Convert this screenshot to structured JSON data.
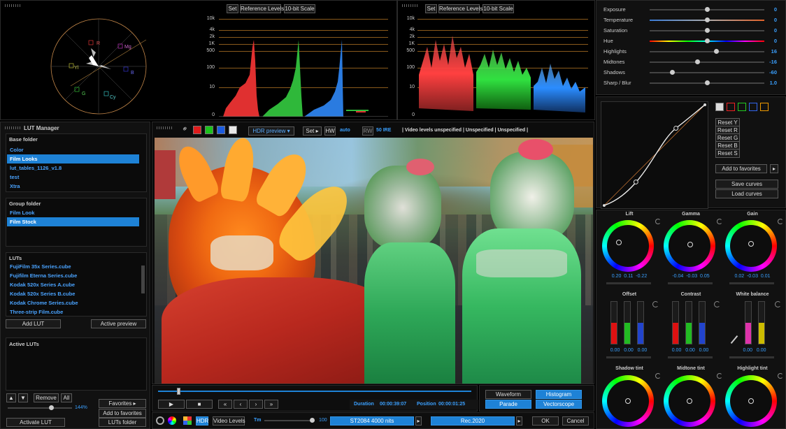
{
  "scopes": {
    "set_label": "Set",
    "ref_levels_label": "Reference Levels",
    "bit_scale_label": "10-bit Scale",
    "ticks": [
      "10k",
      "4k",
      "2k",
      "1K",
      "500",
      "100",
      "10",
      "0"
    ],
    "vectorscope_targets": [
      "R",
      "Mg",
      "B",
      "Cy",
      "G",
      "Yl"
    ]
  },
  "colors": {
    "accent": "#1e82d6",
    "value": "#3aa0ff",
    "grid": "#8a5a1c"
  },
  "lut_manager": {
    "title": "LUT Manager",
    "base_folder": {
      "title": "Base folder",
      "items": [
        "Color",
        "Film Looks",
        "lut_tables_1126_v1.8",
        "test",
        "Xtra"
      ],
      "selected": 1
    },
    "group_folder": {
      "title": "Group folder",
      "items": [
        "Film Look",
        "Film Stock"
      ],
      "selected": 1
    },
    "luts": {
      "title": "LUTs",
      "items": [
        "FujiFilm 35x Series.cube",
        "Fujifilm Eterna Series.cube",
        "Kodak 520x Series A.cube",
        "Kodak 520x Series B.cube",
        "Kodak Chrome Series.cube",
        "Three-strip Film.cube"
      ]
    },
    "add_lut": "Add LUT",
    "active_preview": "Active preview",
    "active_luts_title": "Active LUTs",
    "remove": "Remove",
    "all": "All",
    "favorites": "Favorites",
    "add_to_favorites": "Add to favorites",
    "percent": "144%",
    "activate_lut": "Activate LUT",
    "luts_folder": "LUTs folder"
  },
  "viewer": {
    "hdr_preview": "HDR preview",
    "set": "Set",
    "hw": "HW",
    "auto": "auto",
    "rw": "RW",
    "ire": "50 IRE",
    "status": "| Video levels unspecified | Unspecified | Unspecified |"
  },
  "transport": {
    "duration_label": "Duration",
    "duration": "00:00:39:07",
    "position_label": "Position",
    "position": "00:00:01:25",
    "playhead": 0.03
  },
  "scope_buttons": {
    "waveform": "Waveform",
    "histogram": "Histogram",
    "parade": "Parade",
    "vectorscope": "Vectorscope"
  },
  "bottom_bar": {
    "hdr": "HDR",
    "video_levels": "Video Levels",
    "tm": "Tm",
    "tm_value": "100",
    "st2084": "ST2084 4000 nits",
    "rec2020": "Rec.2020",
    "ok": "OK",
    "cancel": "Cancel"
  },
  "adjust": [
    {
      "label": "Exposure",
      "value": "0",
      "pos": 0.5
    },
    {
      "label": "Temperature",
      "value": "0",
      "pos": 0.5
    },
    {
      "label": "Saturation",
      "value": "0",
      "pos": 0.5
    },
    {
      "label": "Hue",
      "value": "0",
      "pos": 0.5
    },
    {
      "label": "Highlights",
      "value": "16",
      "pos": 0.58
    },
    {
      "label": "Midtones",
      "value": "-16",
      "pos": 0.42
    },
    {
      "label": "Shadows",
      "value": "-60",
      "pos": 0.2
    },
    {
      "label": "Sharp / Blur",
      "value": "1.0",
      "pos": 0.5
    }
  ],
  "curves": {
    "reset_y": "Reset Y",
    "reset_r": "Reset R",
    "reset_g": "Reset G",
    "reset_b": "Reset B",
    "reset_s": "Reset S",
    "add_to_favorites": "Add to favorites",
    "save": "Save curves",
    "load": "Load curves"
  },
  "wheels": {
    "lift": {
      "label": "Lift",
      "values": [
        "0.20",
        "0.11",
        "-0.22"
      ]
    },
    "gamma": {
      "label": "Gamma",
      "values": [
        "-0.04",
        "-0.03",
        "0.05"
      ]
    },
    "gain": {
      "label": "Gain",
      "values": [
        "0.02",
        "-0.03",
        "0.01"
      ]
    },
    "offset": {
      "label": "Offset",
      "values": [
        "0.00",
        "0.00",
        "0.00"
      ]
    },
    "contrast": {
      "label": "Contrast",
      "values": [
        "0.00",
        "0.00",
        "0.00"
      ]
    },
    "white_balance": {
      "label": "White balance",
      "values": [
        "0.00",
        "0.00"
      ]
    },
    "shadow_tint": {
      "label": "Shadow tint"
    },
    "midtone_tint": {
      "label": "Midtone tint"
    },
    "highlight_tint": {
      "label": "Highlight tint"
    }
  }
}
